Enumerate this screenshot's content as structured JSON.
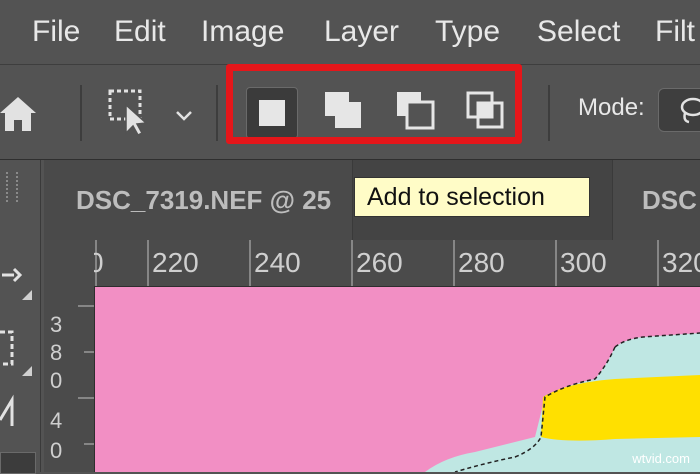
{
  "menu": {
    "items": [
      "File",
      "Edit",
      "Image",
      "Layer",
      "Type",
      "Select",
      "Filt"
    ]
  },
  "options_bar": {
    "mode_label": "Mode:",
    "selection_modes": [
      {
        "name": "new-selection",
        "active": true
      },
      {
        "name": "add-to-selection",
        "active": false
      },
      {
        "name": "subtract-from-selection",
        "active": false
      },
      {
        "name": "intersect-with-selection",
        "active": false
      }
    ]
  },
  "tabs": {
    "active_doc": "DSC_7319.NEF @ 25",
    "next_doc": "DSC"
  },
  "tooltip": {
    "text": "Add to selection"
  },
  "rulers": {
    "top_labels": [
      "0",
      "220",
      "240",
      "260",
      "280",
      "300",
      "320"
    ],
    "left_labels": [
      "3",
      "8",
      "0",
      "4",
      "0"
    ]
  },
  "colors": {
    "highlight": "#e5161a",
    "canvas_pink": "#f28fc4",
    "canvas_cyan": "#bfe7e3",
    "canvas_yellow": "#ffe000",
    "tooltip_bg": "#fffcc7"
  },
  "watermark": "wtvid.com"
}
